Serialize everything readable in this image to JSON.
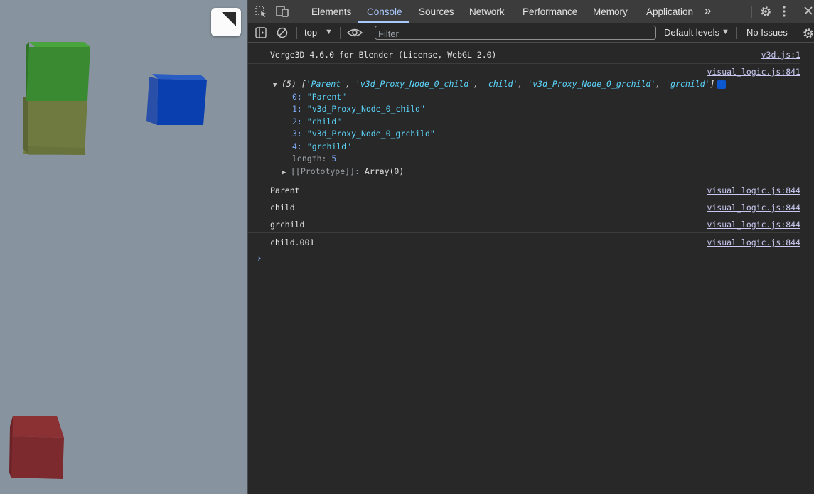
{
  "viewport": {
    "background": "#87939e",
    "cubes": [
      {
        "name": "green-cube",
        "color": "#3a8a31"
      },
      {
        "name": "olive-cube",
        "color": "#6f7a40"
      },
      {
        "name": "blue-cube",
        "color": "#1343a8"
      },
      {
        "name": "red-cube",
        "color": "#7d2a2e"
      }
    ]
  },
  "toolbar": {
    "tabs": [
      "Elements",
      "Console",
      "Sources",
      "Network",
      "Performance",
      "Memory",
      "Application"
    ],
    "active_tab": "Console",
    "more_tabs": "»",
    "settings_icon": "gear-icon",
    "menu_icon": "kebab-icon",
    "close_icon": "close-icon"
  },
  "console_toolbar": {
    "context": "top",
    "filter_placeholder": "Filter",
    "levels": "Default levels",
    "issues": "No Issues"
  },
  "messages": {
    "header": {
      "text": "Verge3D 4.6.0 for Blender (License, WebGL 2.0)",
      "source": "v3d.js:1"
    },
    "array_source": "visual_logic.js:841",
    "array_summary": {
      "count": "(5)",
      "open": "[",
      "items": [
        "'Parent'",
        "'v3d_Proxy_Node_0_child'",
        "'child'",
        "'v3d_Proxy_Node_0_grchild'",
        "'grchild'"
      ],
      "close": "]"
    },
    "array_entries": [
      {
        "key": "0:",
        "value": "\"Parent\""
      },
      {
        "key": "1:",
        "value": "\"v3d_Proxy_Node_0_child\""
      },
      {
        "key": "2:",
        "value": "\"child\""
      },
      {
        "key": "3:",
        "value": "\"v3d_Proxy_Node_0_grchild\""
      },
      {
        "key": "4:",
        "value": "\"grchild\""
      }
    ],
    "length_key": "length:",
    "length_value": "5",
    "prototype_key": "[[Prototype]]:",
    "prototype_value": "Array(0)",
    "logs": [
      {
        "text": "Parent",
        "source": "visual_logic.js:844"
      },
      {
        "text": "child",
        "source": "visual_logic.js:844"
      },
      {
        "text": "grchild",
        "source": "visual_logic.js:844"
      },
      {
        "text": "child.001",
        "source": "visual_logic.js:844"
      }
    ]
  },
  "prompt": "›"
}
